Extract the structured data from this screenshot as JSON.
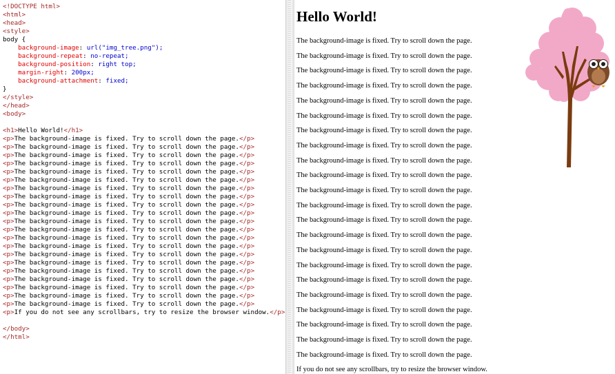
{
  "editor": {
    "lines": [
      [
        {
          "t": "<!DOCTYPE html>",
          "c": "tag"
        }
      ],
      [
        {
          "t": "<html>",
          "c": "tag"
        }
      ],
      [
        {
          "t": "<head>",
          "c": "tag"
        }
      ],
      [
        {
          "t": "<style>",
          "c": "tag"
        }
      ],
      [
        {
          "t": "body {",
          "c": "plain"
        }
      ],
      [
        {
          "t": "    background-image",
          "c": "prop"
        },
        {
          "t": ": ",
          "c": "plain"
        },
        {
          "t": "url(\"img_tree.png\");",
          "c": "val"
        }
      ],
      [
        {
          "t": "    background-repeat",
          "c": "prop"
        },
        {
          "t": ": ",
          "c": "plain"
        },
        {
          "t": "no-repeat;",
          "c": "val"
        }
      ],
      [
        {
          "t": "    background-position",
          "c": "prop"
        },
        {
          "t": ": ",
          "c": "plain"
        },
        {
          "t": "right top;",
          "c": "val"
        }
      ],
      [
        {
          "t": "    margin-right",
          "c": "prop"
        },
        {
          "t": ": ",
          "c": "plain"
        },
        {
          "t": "200px;",
          "c": "val"
        }
      ],
      [
        {
          "t": "    background-attachment",
          "c": "prop"
        },
        {
          "t": ": ",
          "c": "plain"
        },
        {
          "t": "fixed;",
          "c": "val"
        }
      ],
      [
        {
          "t": "}",
          "c": "plain"
        }
      ],
      [
        {
          "t": "</style>",
          "c": "tag"
        }
      ],
      [
        {
          "t": "</head>",
          "c": "tag"
        }
      ],
      [
        {
          "t": "<body>",
          "c": "tag"
        }
      ],
      [],
      [
        {
          "t": "<h1>",
          "c": "tag"
        },
        {
          "t": "Hello World!",
          "c": "plain"
        },
        {
          "t": "</h1>",
          "c": "tag"
        }
      ],
      [
        {
          "t": "<p>",
          "c": "tag"
        },
        {
          "t": "The background-image is fixed. Try to scroll down the page.",
          "c": "plain"
        },
        {
          "t": "</p>",
          "c": "tag"
        }
      ],
      [
        {
          "t": "<p>",
          "c": "tag"
        },
        {
          "t": "The background-image is fixed. Try to scroll down the page.",
          "c": "plain"
        },
        {
          "t": "</p>",
          "c": "tag"
        }
      ],
      [
        {
          "t": "<p>",
          "c": "tag"
        },
        {
          "t": "The background-image is fixed. Try to scroll down the page.",
          "c": "plain"
        },
        {
          "t": "</p>",
          "c": "tag"
        }
      ],
      [
        {
          "t": "<p>",
          "c": "tag"
        },
        {
          "t": "The background-image is fixed. Try to scroll down the page.",
          "c": "plain"
        },
        {
          "t": "</p>",
          "c": "tag"
        }
      ],
      [
        {
          "t": "<p>",
          "c": "tag"
        },
        {
          "t": "The background-image is fixed. Try to scroll down the page.",
          "c": "plain"
        },
        {
          "t": "</p>",
          "c": "tag"
        }
      ],
      [
        {
          "t": "<p>",
          "c": "tag"
        },
        {
          "t": "The background-image is fixed. Try to scroll down the page.",
          "c": "plain"
        },
        {
          "t": "</p>",
          "c": "tag"
        }
      ],
      [
        {
          "t": "<p>",
          "c": "tag"
        },
        {
          "t": "The background-image is fixed. Try to scroll down the page.",
          "c": "plain"
        },
        {
          "t": "</p>",
          "c": "tag"
        }
      ],
      [
        {
          "t": "<p>",
          "c": "tag"
        },
        {
          "t": "The background-image is fixed. Try to scroll down the page.",
          "c": "plain"
        },
        {
          "t": "</p>",
          "c": "tag"
        }
      ],
      [
        {
          "t": "<p>",
          "c": "tag"
        },
        {
          "t": "The background-image is fixed. Try to scroll down the page.",
          "c": "plain"
        },
        {
          "t": "</p>",
          "c": "tag"
        }
      ],
      [
        {
          "t": "<p>",
          "c": "tag"
        },
        {
          "t": "The background-image is fixed. Try to scroll down the page.",
          "c": "plain"
        },
        {
          "t": "</p>",
          "c": "tag"
        }
      ],
      [
        {
          "t": "<p>",
          "c": "tag"
        },
        {
          "t": "The background-image is fixed. Try to scroll down the page.",
          "c": "plain"
        },
        {
          "t": "</p>",
          "c": "tag"
        }
      ],
      [
        {
          "t": "<p>",
          "c": "tag"
        },
        {
          "t": "The background-image is fixed. Try to scroll down the page.",
          "c": "plain"
        },
        {
          "t": "</p>",
          "c": "tag"
        }
      ],
      [
        {
          "t": "<p>",
          "c": "tag"
        },
        {
          "t": "The background-image is fixed. Try to scroll down the page.",
          "c": "plain"
        },
        {
          "t": "</p>",
          "c": "tag"
        }
      ],
      [
        {
          "t": "<p>",
          "c": "tag"
        },
        {
          "t": "The background-image is fixed. Try to scroll down the page.",
          "c": "plain"
        },
        {
          "t": "</p>",
          "c": "tag"
        }
      ],
      [
        {
          "t": "<p>",
          "c": "tag"
        },
        {
          "t": "The background-image is fixed. Try to scroll down the page.",
          "c": "plain"
        },
        {
          "t": "</p>",
          "c": "tag"
        }
      ],
      [
        {
          "t": "<p>",
          "c": "tag"
        },
        {
          "t": "The background-image is fixed. Try to scroll down the page.",
          "c": "plain"
        },
        {
          "t": "</p>",
          "c": "tag"
        }
      ],
      [
        {
          "t": "<p>",
          "c": "tag"
        },
        {
          "t": "The background-image is fixed. Try to scroll down the page.",
          "c": "plain"
        },
        {
          "t": "</p>",
          "c": "tag"
        }
      ],
      [
        {
          "t": "<p>",
          "c": "tag"
        },
        {
          "t": "The background-image is fixed. Try to scroll down the page.",
          "c": "plain"
        },
        {
          "t": "</p>",
          "c": "tag"
        }
      ],
      [
        {
          "t": "<p>",
          "c": "tag"
        },
        {
          "t": "The background-image is fixed. Try to scroll down the page.",
          "c": "plain"
        },
        {
          "t": "</p>",
          "c": "tag"
        }
      ],
      [
        {
          "t": "<p>",
          "c": "tag"
        },
        {
          "t": "The background-image is fixed. Try to scroll down the page.",
          "c": "plain"
        },
        {
          "t": "</p>",
          "c": "tag"
        }
      ],
      [
        {
          "t": "<p>",
          "c": "tag"
        },
        {
          "t": "The background-image is fixed. Try to scroll down the page.",
          "c": "plain"
        },
        {
          "t": "</p>",
          "c": "tag"
        }
      ],
      [
        {
          "t": "<p>",
          "c": "tag"
        },
        {
          "t": "If you do not see any scrollbars, try to resize the browser window.",
          "c": "plain"
        },
        {
          "t": "</p>",
          "c": "tag"
        }
      ],
      [],
      [
        {
          "t": "</body>",
          "c": "tag"
        }
      ],
      [
        {
          "t": "</html>",
          "c": "tag"
        }
      ]
    ]
  },
  "result": {
    "heading": "Hello World!",
    "paragraphs": [
      "The background-image is fixed. Try to scroll down the page.",
      "The background-image is fixed. Try to scroll down the page.",
      "The background-image is fixed. Try to scroll down the page.",
      "The background-image is fixed. Try to scroll down the page.",
      "The background-image is fixed. Try to scroll down the page.",
      "The background-image is fixed. Try to scroll down the page.",
      "The background-image is fixed. Try to scroll down the page.",
      "The background-image is fixed. Try to scroll down the page.",
      "The background-image is fixed. Try to scroll down the page.",
      "The background-image is fixed. Try to scroll down the page.",
      "The background-image is fixed. Try to scroll down the page.",
      "The background-image is fixed. Try to scroll down the page.",
      "The background-image is fixed. Try to scroll down the page.",
      "The background-image is fixed. Try to scroll down the page.",
      "The background-image is fixed. Try to scroll down the page.",
      "The background-image is fixed. Try to scroll down the page.",
      "The background-image is fixed. Try to scroll down the page.",
      "The background-image is fixed. Try to scroll down the page.",
      "The background-image is fixed. Try to scroll down the page.",
      "The background-image is fixed. Try to scroll down the page.",
      "The background-image is fixed. Try to scroll down the page.",
      "The background-image is fixed. Try to scroll down the page.",
      "If you do not see any scrollbars, try to resize the browser window."
    ],
    "background_image": "tree-with-owl-image"
  },
  "colors": {
    "tag": "#a52a2a",
    "property": "#e00000",
    "value": "#0000cd",
    "tree_blossom": "#f2a9c8",
    "tree_trunk": "#7a3b10"
  }
}
